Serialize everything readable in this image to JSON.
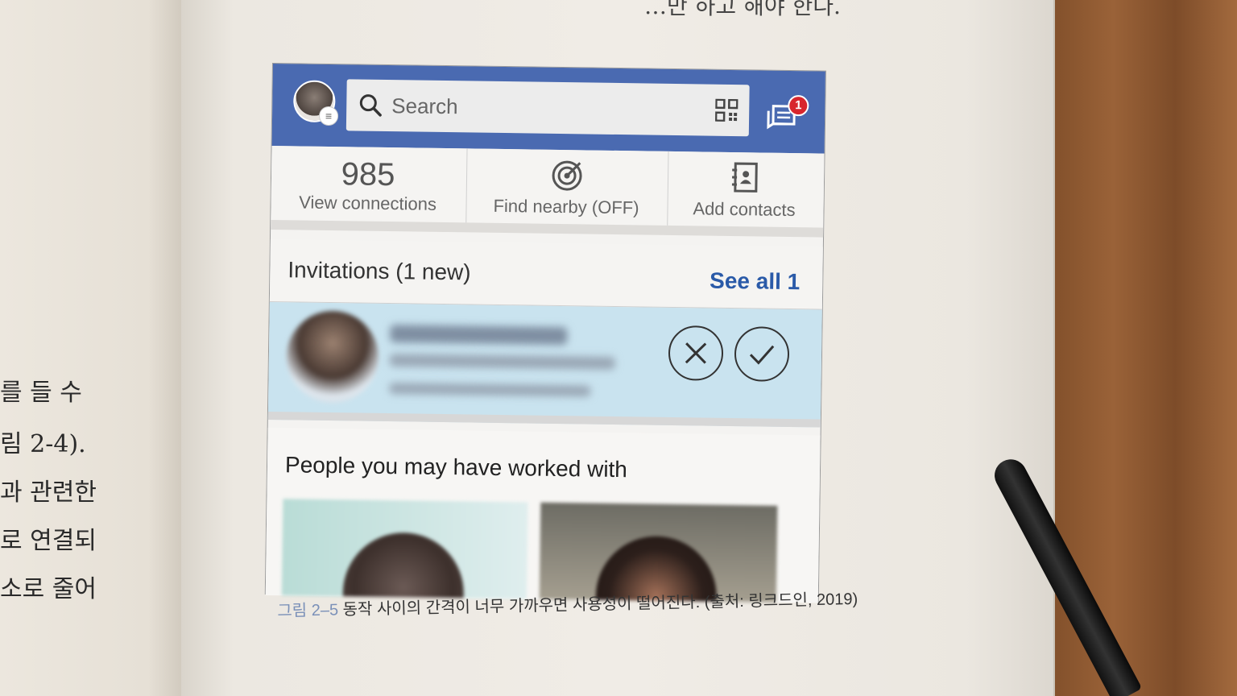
{
  "book": {
    "top_text": "…만 하고 해야 한다.",
    "left_lines": [
      "를 들 수",
      "림 2-4).",
      "과 관련한",
      "로 연결되",
      "소로 줄어"
    ],
    "caption_number": "그림 2–5",
    "caption_text": "동작 사이의 간격이 너무 가까우면 사용성이 떨어진다. (출처: 링크드인, 2019)"
  },
  "app": {
    "header": {
      "search_placeholder": "Search",
      "avatar_icon": "profile-avatar",
      "qr_icon": "qr-code-icon",
      "messages_icon": "messages-icon",
      "messages_badge": "1",
      "accent": "#4a6ab1"
    },
    "stats": [
      {
        "number": "985",
        "label": "View connections"
      },
      {
        "icon": "radar-icon",
        "label": "Find nearby (OFF)"
      },
      {
        "icon": "contacts-book-icon",
        "label": "Add contacts"
      }
    ],
    "invitations": {
      "title": "Invitations (1 new)",
      "see_all": "See all 1",
      "row_color": "#c9e3ef",
      "reject_icon": "close-icon",
      "accept_icon": "check-icon"
    },
    "people": {
      "title": "People you may have worked with"
    }
  }
}
